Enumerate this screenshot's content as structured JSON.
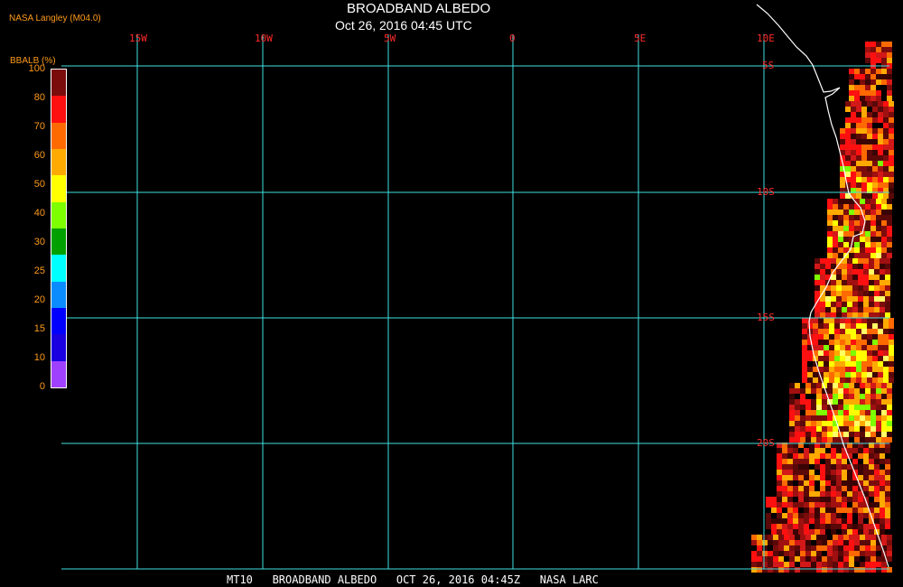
{
  "header": {
    "credit": "NASA Langley (M04.0)",
    "title": "BROADBAND ALBEDO",
    "subtitle": "Oct 26, 2016 04:45 UTC"
  },
  "legend": {
    "title": "BBALB (%)",
    "ticks": [
      "100",
      "80",
      "70",
      "60",
      "50",
      "40",
      "30",
      "25",
      "20",
      "15",
      "10",
      "0"
    ],
    "colors": [
      "#7a0c0c",
      "#ff1010",
      "#ff6a00",
      "#ffaa00",
      "#ffff00",
      "#7dff00",
      "#00a000",
      "#00ffff",
      "#0a8cff",
      "#0000ff",
      "#1a00e0",
      "#a040ff"
    ]
  },
  "graticule": {
    "longitude_labels": [
      "15W",
      "10W",
      "5W",
      "0",
      "5E",
      "10E"
    ],
    "latitude_labels": [
      "5S",
      "10S",
      "15S",
      "20S"
    ],
    "line_color": "#40e0e0",
    "label_color": "#ff2a2a"
  },
  "footer": {
    "text": "MT10   BROADBAND ALBEDO   OCT 26, 2016 04:45Z   NASA LARC"
  },
  "colors": {
    "background": "#000000",
    "coastline": "#ffffff"
  }
}
